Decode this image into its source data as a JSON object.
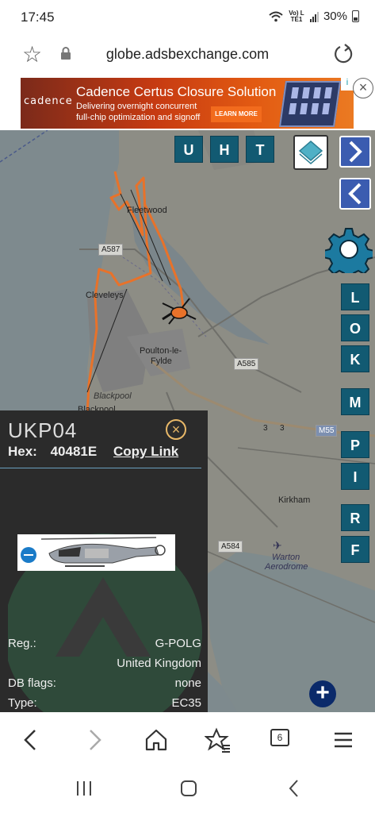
{
  "status": {
    "time": "17:45",
    "battery": "30%",
    "network": "Vo) LTE1"
  },
  "browser": {
    "url": "globe.adsbexchange.com",
    "tab_count": "6"
  },
  "ad": {
    "brand": "cadence",
    "title": "Cadence Certus Closure Solution",
    "line1": "Delivering overnight concurrent",
    "line2": "full-chip optimization and signoff",
    "cta": "LEARN MORE",
    "info": "i",
    "close": "×"
  },
  "map": {
    "labels": {
      "fleetwood": "Fleetwood",
      "cleveleys": "Cleveleys",
      "poulton1": "Poulton-le-",
      "poulton2": "Fylde",
      "blackpool_italic": "Blackpool",
      "blackpool": "Blackpool",
      "kirkham": "Kirkham",
      "warton1": "Warton",
      "warton2": "Aerodrome"
    },
    "roads": {
      "a587": "A587",
      "a585": "A585",
      "m55": "M55",
      "a584": "A584",
      "r3a": "3",
      "r3b": "3"
    },
    "buttons": {
      "u": "U",
      "h": "H",
      "t": "T",
      "l": "L",
      "o": "O",
      "k": "K",
      "m": "M",
      "p": "P",
      "i": "I",
      "r": "R",
      "f": "F",
      "zoom_in": "+"
    }
  },
  "aircraft": {
    "callsign": "UKP04",
    "hex_label": "Hex:",
    "hex": "40481E",
    "copy_link": "Copy Link",
    "rows": [
      {
        "key": "Reg.:",
        "value": "G-POLG"
      },
      {
        "key": "",
        "value": "United Kingdom"
      },
      {
        "key": "DB flags:",
        "value": "none"
      },
      {
        "key": "Type:",
        "value": "EC35"
      }
    ]
  },
  "colors": {
    "track": "#e8722a",
    "button": "#125a72",
    "panel": "#2b2b2b"
  }
}
